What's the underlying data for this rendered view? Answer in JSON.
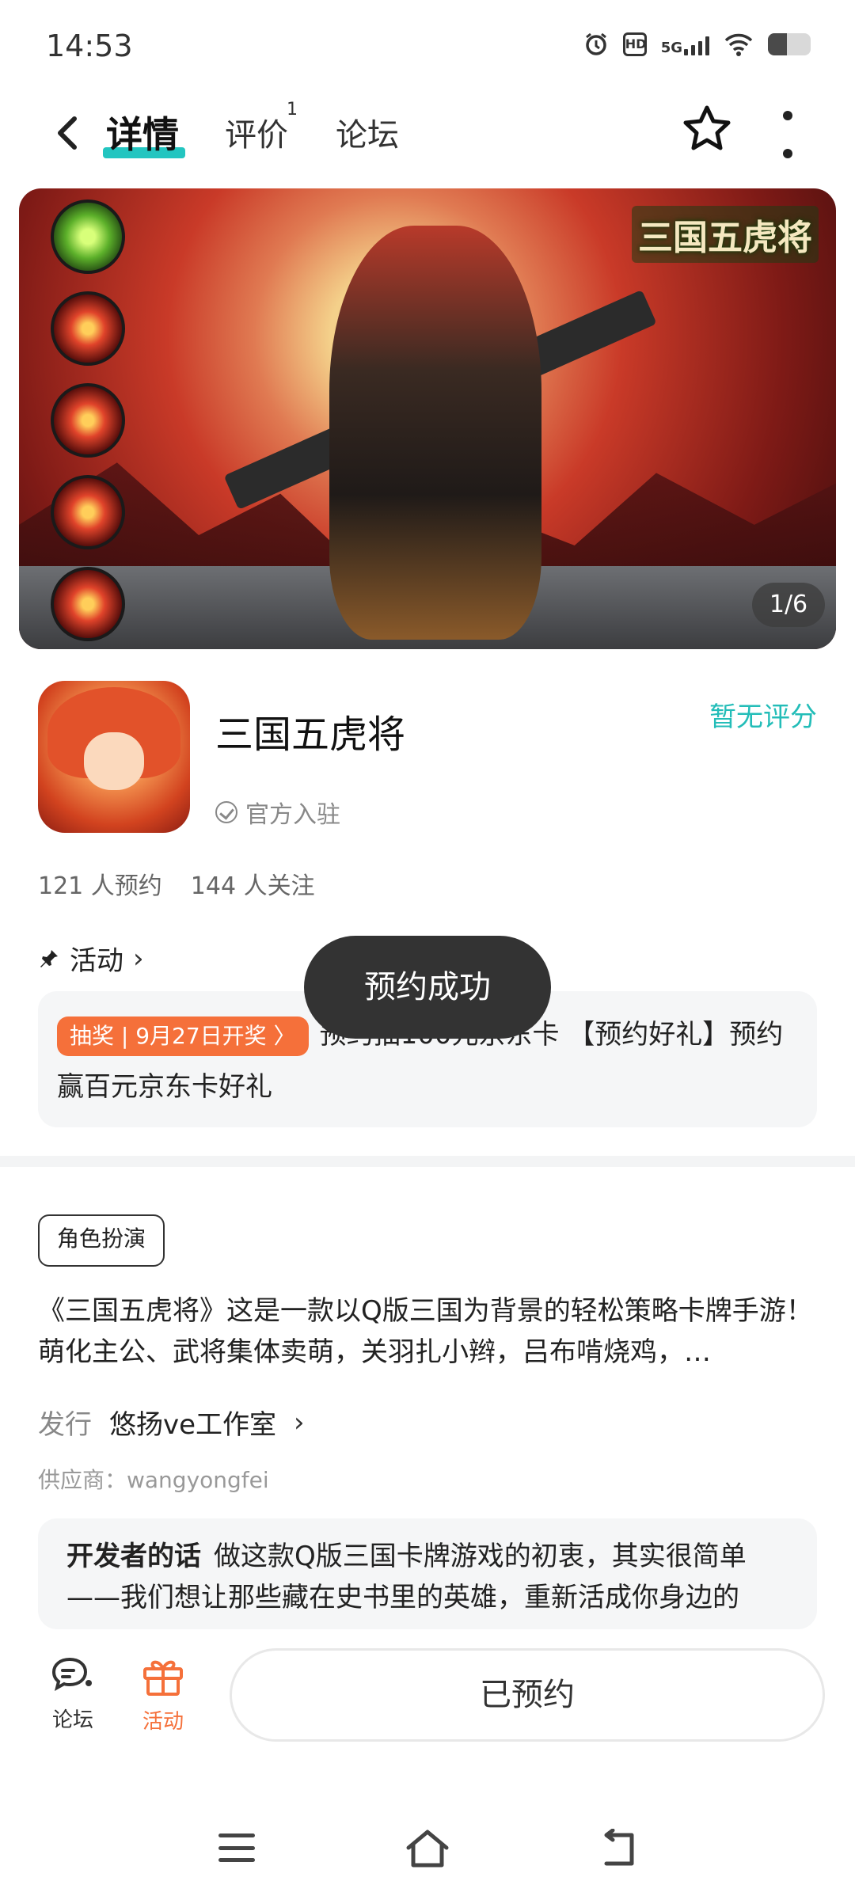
{
  "status_bar": {
    "time": "14:53",
    "hd_label": "HD",
    "network_label": "5G",
    "battery_level": 0.45
  },
  "header": {
    "tabs": [
      {
        "label": "详情",
        "active": true
      },
      {
        "label": "评价",
        "badge": "1"
      },
      {
        "label": "论坛"
      }
    ]
  },
  "banner": {
    "logo_text": "三国五虎将",
    "counter": "1/6"
  },
  "app": {
    "title": "三国五虎将",
    "rating": "暂无评分",
    "official_label": "官方入驻",
    "reservations": "121 人预约",
    "followers": "144 人关注"
  },
  "activity": {
    "heading": "活动",
    "tag": "抽奖 | 9月27日开奖 〉",
    "text": "预约抽100元京东卡 【预约好礼】预约赢百元京东卡好礼"
  },
  "toast": "预约成功",
  "details": {
    "genre": "角色扮演",
    "description": "《三国五虎将》这是一款以Q版三国为背景的轻松策略卡牌手游！萌化主公、武将集体卖萌，关羽扎小辫，吕布啃烧鸡，…",
    "publisher_label": "发行",
    "publisher": "悠扬ve工作室",
    "supplier": "供应商：wangyongfei",
    "dev_title": "开发者的话",
    "dev_text": "做这款Q版三国卡牌游戏的初衷，其实很简单——我们想让那些藏在史书里的英雄，重新活成你身边的"
  },
  "bottom_bar": {
    "forum_label": "论坛",
    "activity_label": "活动",
    "reserve_button": "已预约"
  },
  "colors": {
    "accent": "#23c5c0",
    "orange": "#f5703a",
    "toast_bg": "#333333"
  }
}
